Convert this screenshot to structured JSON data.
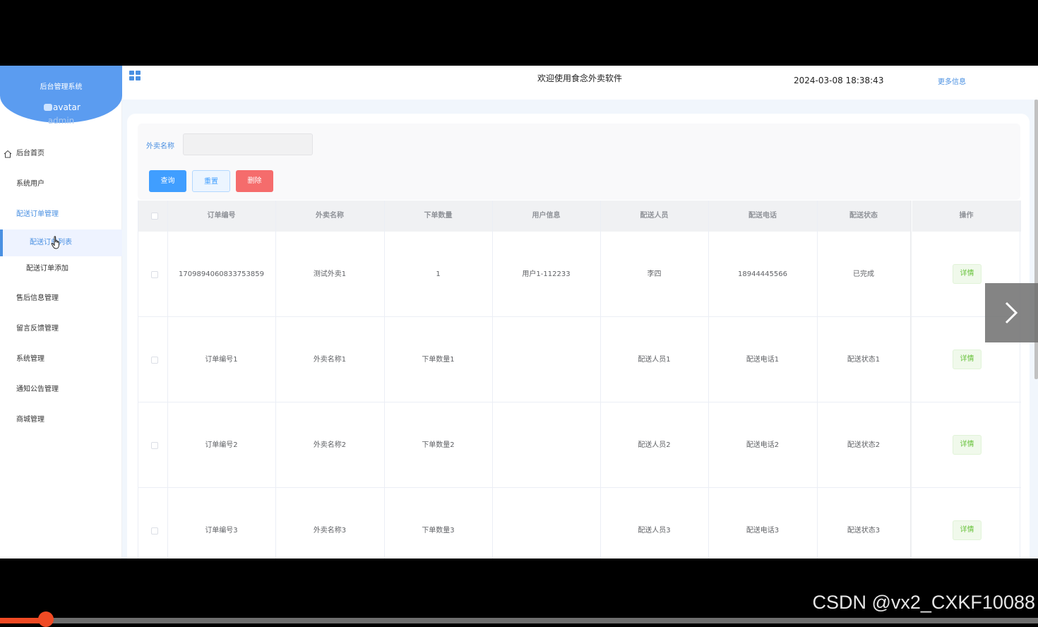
{
  "sidebar": {
    "system_title": "后台管理系统",
    "avatar_alt": "avatar",
    "username": "admin",
    "items": [
      {
        "label": "后台首页"
      },
      {
        "label": "系统用户"
      },
      {
        "label": "配送订单管理"
      },
      {
        "label": "配送订单列表"
      },
      {
        "label": "配送订单添加"
      },
      {
        "label": "售后信息管理"
      },
      {
        "label": "留言反馈管理"
      },
      {
        "label": "系统管理"
      },
      {
        "label": "通知公告管理"
      },
      {
        "label": "商城管理"
      }
    ]
  },
  "header": {
    "welcome": "欢迎使用食念外卖软件",
    "datetime": "2024-03-08 18:38:43",
    "more_info": "更多信息"
  },
  "search": {
    "label": "外卖名称",
    "value": "",
    "query_button": "查询",
    "reset_button": "重置",
    "delete_button": "删除"
  },
  "table": {
    "columns": [
      "订单编号",
      "外卖名称",
      "下单数量",
      "用户信息",
      "配送人员",
      "配送电话",
      "配送状态",
      "操作"
    ],
    "rows": [
      {
        "order_no": "1709894060833753859",
        "name": "测试外卖1",
        "qty": "1",
        "user": "用户1-112233",
        "courier": "李四",
        "phone": "18944445566",
        "status": "已完成",
        "action": "详情"
      },
      {
        "order_no": "订单编号1",
        "name": "外卖名称1",
        "qty": "下单数量1",
        "user": "",
        "courier": "配送人员1",
        "phone": "配送电话1",
        "status": "配送状态1",
        "action": "详情"
      },
      {
        "order_no": "订单编号2",
        "name": "外卖名称2",
        "qty": "下单数量2",
        "user": "",
        "courier": "配送人员2",
        "phone": "配送电话2",
        "status": "配送状态2",
        "action": "详情"
      },
      {
        "order_no": "订单编号3",
        "name": "外卖名称3",
        "qty": "下单数量3",
        "user": "",
        "courier": "配送人员3",
        "phone": "配送电话3",
        "status": "配送状态3",
        "action": "详情"
      }
    ]
  },
  "video": {
    "watermark": "CSDN @vx2_CXKF10088",
    "progress": 0.044
  },
  "colors": {
    "accent": "#409eff",
    "sidebar_head": "#5b9cf0",
    "danger": "#f56c6c",
    "success": "#67c23a",
    "progress": "#f04a24"
  }
}
